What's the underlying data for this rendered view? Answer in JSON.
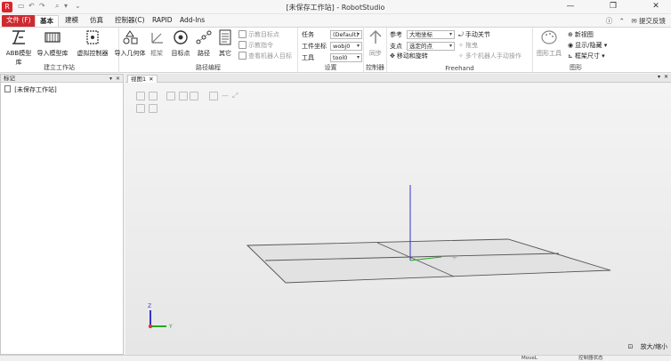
{
  "window": {
    "title": "[未保存工作站] - RobotStudio",
    "minimize_glyph": "—",
    "maximize_glyph": "❐",
    "close_glyph": "✕"
  },
  "quick_access": {
    "undo_icon": "undo-icon",
    "search_icon": "search-icon",
    "customize_icon": "chevron-down-icon"
  },
  "tabs": [
    {
      "label": "文件 (F)"
    },
    {
      "label": "基本"
    },
    {
      "label": "建模"
    },
    {
      "label": "仿真"
    },
    {
      "label": "控制器(C)"
    },
    {
      "label": "RAPID"
    },
    {
      "label": "Add-Ins"
    }
  ],
  "help": {
    "label": "提交反馈"
  },
  "ribbon": {
    "build_station": {
      "label": "建立工作站",
      "abb_library": "ABB模型库",
      "import_library": "导入模型库",
      "virtual_controller": "虚拟控制器"
    },
    "path_programming": {
      "label": "路径编程",
      "import_geometry": "导入几何体",
      "frame": "框架",
      "target": "目标点",
      "path": "路径",
      "other": "其它",
      "show_targets": "示教目标点",
      "teach_instruction": "示教指令",
      "view_robot_targets": "查看机器人目标"
    },
    "settings": {
      "label": "设置",
      "task_label": "任务",
      "task_value": "(Default)",
      "wobj_label": "工件坐标",
      "wobj_value": "wobj0",
      "tool_label": "工具",
      "tool_value": "tool0"
    },
    "controller": {
      "label": "控制器",
      "sync": "同步"
    },
    "freehand": {
      "label": "Freehand",
      "reference_label": "参考",
      "reference_value": "大地坐标",
      "pivot_label": "支点",
      "pivot_value": "选定的点",
      "move_rotate": "移动和旋转",
      "jog_joint": "手动关节",
      "drag": "拖曳",
      "multi_robot": "多个机器人手动操作"
    },
    "graphics": {
      "label": "图形",
      "graphic_tools": "图形工具",
      "new_view": "新视图",
      "show_hide": "显示/隐藏",
      "frame_size": "框架尺寸"
    }
  },
  "left_panel": {
    "title": "标记",
    "tree_root": "[未保存工作站]"
  },
  "view": {
    "tab_label": "视图1",
    "axis_z": "Z",
    "axis_y": "Y"
  },
  "status": {
    "zoom": "放大/缩小",
    "move": "MoveL",
    "controller_status": "控制器状态"
  },
  "colors": {
    "file_tab": "#cf2a2f",
    "accent_red": "#d9262c",
    "axis_x": "#d33",
    "axis_y": "#2a2",
    "axis_z": "#33c"
  }
}
